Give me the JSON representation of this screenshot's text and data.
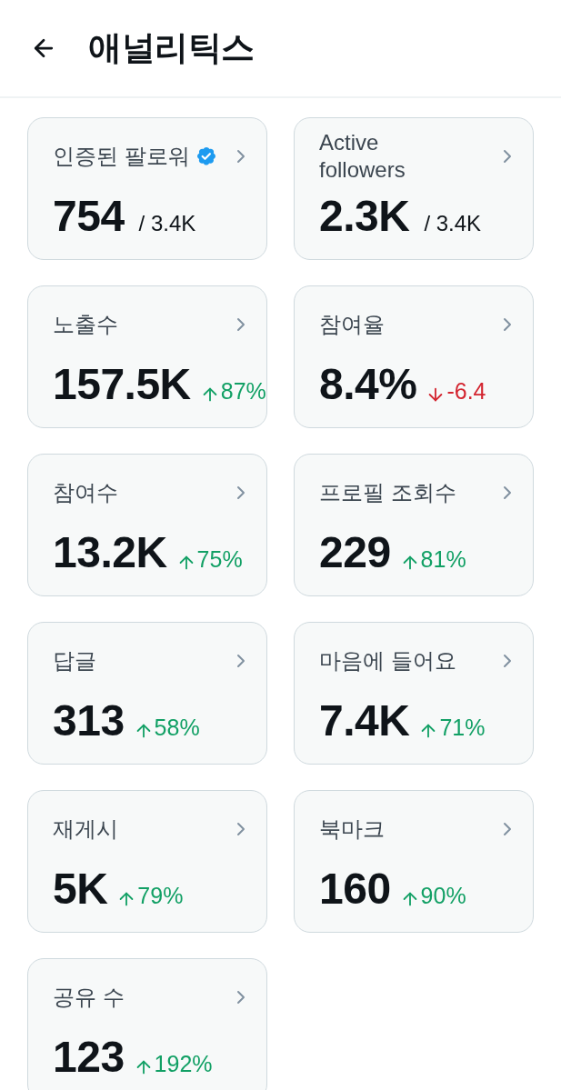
{
  "header": {
    "title": "애널리틱스"
  },
  "metrics": [
    {
      "kind": "ratio",
      "label": "인증된 팔로워",
      "verified": true,
      "value": "754",
      "total": "/ 3.4K"
    },
    {
      "kind": "ratio",
      "label": "Active followers",
      "verified": false,
      "value": "2.3K",
      "total": "/ 3.4K"
    },
    {
      "kind": "rise",
      "label": "노출수",
      "verified": false,
      "value": "157.5K",
      "change": "87%"
    },
    {
      "kind": "fall",
      "label": "참여율",
      "verified": false,
      "value": "8.4%",
      "change": "-6.4"
    },
    {
      "kind": "rise",
      "label": "참여수",
      "verified": false,
      "value": "13.2K",
      "change": "75%"
    },
    {
      "kind": "rise",
      "label": "프로필 조회수",
      "verified": false,
      "value": "229",
      "change": "81%"
    },
    {
      "kind": "rise",
      "label": "답글",
      "verified": false,
      "value": "313",
      "change": "58%"
    },
    {
      "kind": "rise",
      "label": "마음에 들어요",
      "verified": false,
      "value": "7.4K",
      "change": "71%"
    },
    {
      "kind": "rise",
      "label": "재게시",
      "verified": false,
      "value": "5K",
      "change": "79%"
    },
    {
      "kind": "rise",
      "label": "북마크",
      "verified": false,
      "value": "160",
      "change": "90%"
    },
    {
      "kind": "rise",
      "label": "공유 수",
      "verified": false,
      "value": "123",
      "change": "192%"
    }
  ]
}
